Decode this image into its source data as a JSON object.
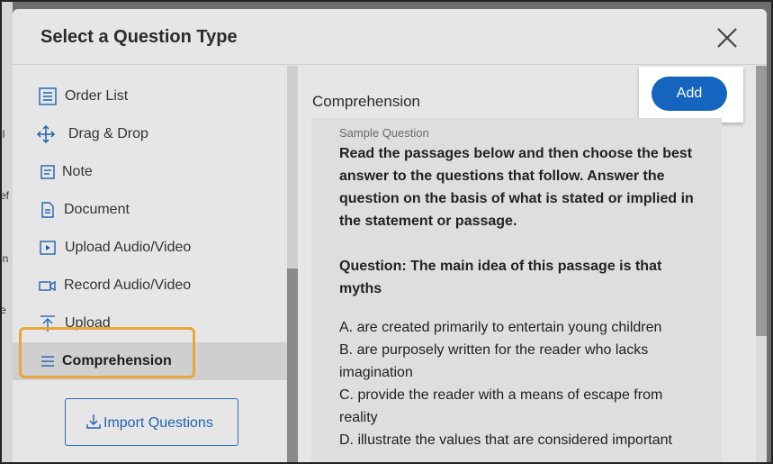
{
  "background": {
    "fragments": [
      "ll",
      "ef",
      "in",
      "e"
    ]
  },
  "modal": {
    "title": "Select a Question Type",
    "close_label": "×"
  },
  "sidebar": {
    "items": [
      {
        "label": "Order List",
        "icon": "order-list-icon"
      },
      {
        "label": "Drag & Drop",
        "icon": "drag-drop-icon"
      },
      {
        "label": "Note",
        "icon": "note-icon"
      },
      {
        "label": "Document",
        "icon": "document-icon"
      },
      {
        "label": "Upload Audio/Video",
        "icon": "upload-audio-video-icon"
      },
      {
        "label": "Record Audio/Video",
        "icon": "record-audio-video-icon"
      },
      {
        "label": "Upload",
        "icon": "upload-icon"
      },
      {
        "label": "Comprehension",
        "icon": "comprehension-icon",
        "selected": true
      }
    ],
    "import_label": "Import Questions"
  },
  "content": {
    "title": "Comprehension",
    "add_label": "Add",
    "sample_label": "Sample Question",
    "instructions": "Read the passages below and then choose the best answer to the questions that follow. Answer the question on the basis of what is stated or implied in the statement or passage.",
    "question": "Question: The main idea of this passage is that myths",
    "options": [
      "A. are created primarily to entertain young children",
      "B. are purposely written for the reader who lacks imagination",
      "C. provide the reader with a means of escape from reality",
      "D. illustrate the values that are considered important"
    ]
  },
  "colors": {
    "accent": "#1565c0",
    "highlight": "#e8a838"
  }
}
